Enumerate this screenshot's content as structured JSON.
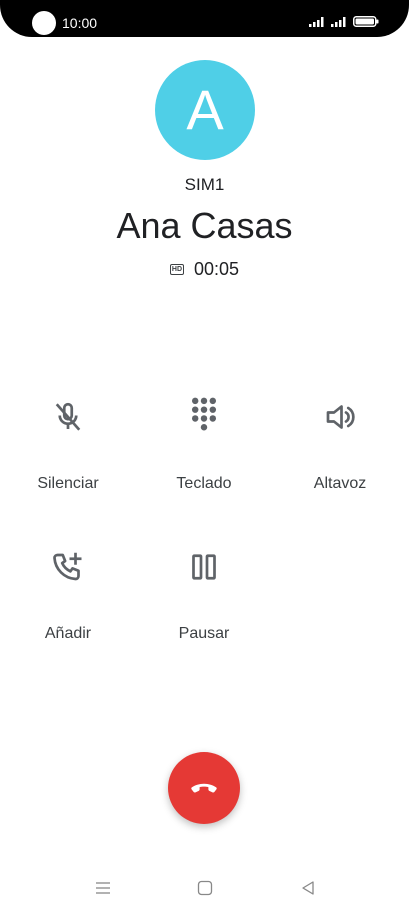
{
  "status_bar": {
    "time": "10:00"
  },
  "contact": {
    "avatar_letter": "A",
    "avatar_color": "#4fcfe7",
    "sim": "SIM1",
    "name": "Ana Casas",
    "hd_badge": "HD",
    "timer": "00:05"
  },
  "actions": {
    "mute": {
      "label": "Silenciar",
      "icon": "mic-off-icon"
    },
    "keypad": {
      "label": "Teclado",
      "icon": "dialpad-icon"
    },
    "speaker": {
      "label": "Altavoz",
      "icon": "speaker-icon"
    },
    "add": {
      "label": "Añadir",
      "icon": "add-call-icon"
    },
    "hold": {
      "label": "Pausar",
      "icon": "pause-icon"
    }
  },
  "end_call": {
    "icon": "end-call-icon",
    "color": "#e53935"
  },
  "nav": {
    "menu": "menu-icon",
    "home": "home-icon",
    "back": "back-icon"
  }
}
